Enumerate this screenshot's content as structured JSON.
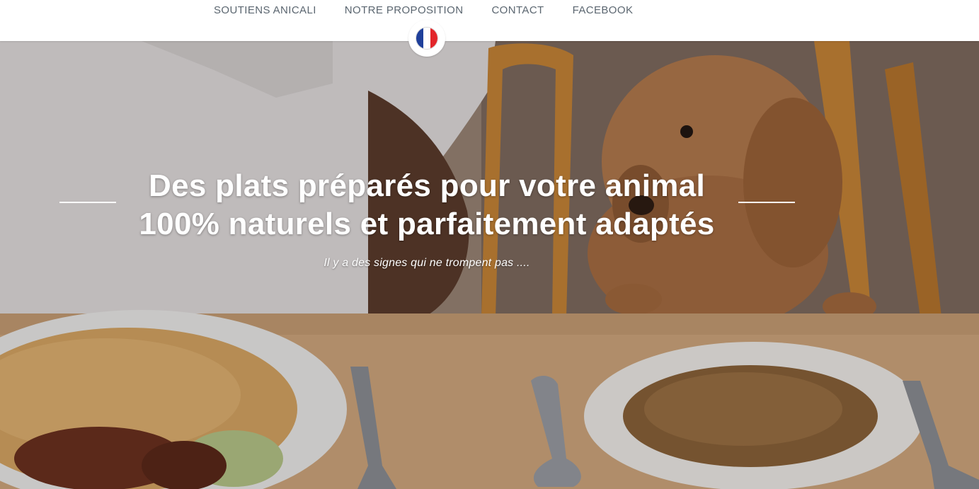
{
  "nav": {
    "items": [
      {
        "label": "SOUTIENS ANICALI"
      },
      {
        "label": "NOTRE PROPOSITION"
      },
      {
        "label": "CONTACT"
      },
      {
        "label": "FACEBOOK"
      }
    ]
  },
  "language": {
    "icon": "france-flag-icon",
    "flag_colors": [
      "#1f3f9a",
      "#ffffff",
      "#e2262b"
    ]
  },
  "hero": {
    "headline_line1": "Des plats préparés pour votre animal",
    "headline_line2": "100% naturels et parfaitement adaptés",
    "tagline": "Il y a des signes qui ne trompent pas ...."
  }
}
